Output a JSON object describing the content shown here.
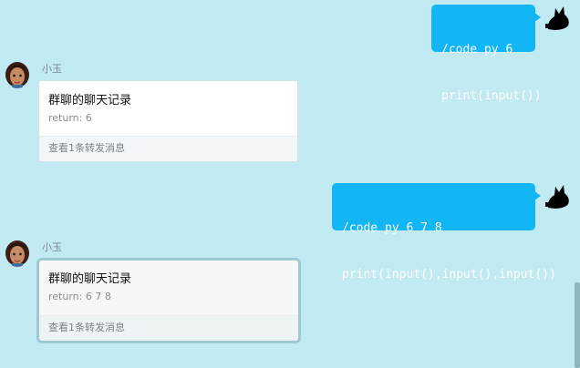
{
  "messages": [
    {
      "lines": [
        "/code py 6",
        "print(input())"
      ]
    },
    {
      "sender": "小玉",
      "card": {
        "title": "群聊的聊天记录",
        "preview": "return: 6",
        "footer": "查看1条转发消息"
      }
    },
    {
      "lines": [
        "/code py 6 7 8",
        "print(input(),input(),input())"
      ]
    },
    {
      "sender": "小玉",
      "card": {
        "title": "群聊的聊天记录",
        "preview": "return: 6 7 8",
        "footer": "查看1条转发消息"
      }
    }
  ],
  "icons": {
    "self_avatar": "black-cat-avatar-icon",
    "other_avatar": "girl-avatar-icon"
  },
  "colors": {
    "background": "#c2eaf2",
    "outgoing_bubble": "#12b6f5",
    "card_background": "#ffffff",
    "selected_border": "#9fc9d2"
  }
}
